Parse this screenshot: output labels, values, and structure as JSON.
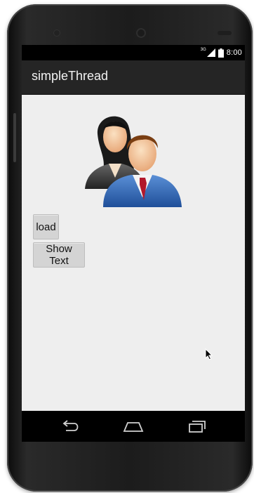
{
  "status_bar": {
    "network_type": "3G",
    "signal_icon": "cell-signal-icon",
    "battery_icon": "battery-icon",
    "time": "8:00"
  },
  "action_bar": {
    "title": "simpleThread"
  },
  "content": {
    "image_icon": "people-icon",
    "buttons": {
      "load_label": "load",
      "show_text_label": "Show Text"
    }
  },
  "nav_bar": {
    "back_icon": "back-icon",
    "home_icon": "home-icon",
    "recents_icon": "recents-icon"
  },
  "colors": {
    "screen_bg": "#eeeeee",
    "action_bar_bg": "#252525",
    "button_bg": "#d4d4d4"
  }
}
